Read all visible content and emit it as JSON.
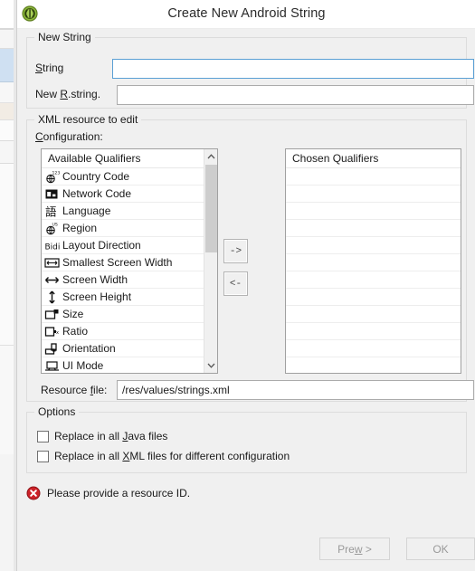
{
  "window": {
    "title": "Create New Android String",
    "icon": "android-green-circle-icon"
  },
  "new_string_group": {
    "title": "New String",
    "fields": [
      {
        "label_pre": "",
        "label_mn": "S",
        "label_post": "tring",
        "value": "",
        "placeholder": "",
        "focused": true
      },
      {
        "label_pre": "New ",
        "label_mn": "R",
        "label_post": ".string.",
        "value": "",
        "placeholder": "",
        "focused": false
      }
    ]
  },
  "xml_group": {
    "title": "XML resource to edit",
    "config_label_mn": "C",
    "config_label_rest": "onfiguration:",
    "available": {
      "header": "Available Qualifiers",
      "items": [
        {
          "icon": "country-code-globe-123-icon",
          "label": "Country Code"
        },
        {
          "icon": "network-code-sim-icon",
          "label": "Network Code"
        },
        {
          "icon": "language-cjk-icon",
          "label": "Language"
        },
        {
          "icon": "region-globe-us-icon",
          "label": "Region"
        },
        {
          "icon": "layout-direction-bidi-icon",
          "label": "Layout Direction"
        },
        {
          "icon": "smallest-screen-width-icon",
          "label": "Smallest Screen Width"
        },
        {
          "icon": "screen-width-arrows-icon",
          "label": "Screen Width"
        },
        {
          "icon": "screen-height-arrows-icon",
          "label": "Screen Height"
        },
        {
          "icon": "size-icon",
          "label": "Size"
        },
        {
          "icon": "ratio-icon",
          "label": "Ratio"
        },
        {
          "icon": "orientation-icon",
          "label": "Orientation"
        },
        {
          "icon": "ui-mode-icon",
          "label": "UI Mode"
        }
      ],
      "scroll_thumb_pct": 45
    },
    "chosen": {
      "header": "Chosen Qualifiers",
      "items": []
    },
    "move_right_label": "->",
    "move_left_label": "<-",
    "resource_file": {
      "label_pre": "Resource ",
      "label_mn": "f",
      "label_post": "ile:",
      "value": "/res/values/strings.xml"
    }
  },
  "options_group": {
    "title": "Options",
    "checkboxes": [
      {
        "pre": "Replace in all ",
        "mn": "J",
        "post": "ava files",
        "checked": false
      },
      {
        "pre": "Replace in all ",
        "mn": "X",
        "post": "ML files for different configuration",
        "checked": false
      }
    ]
  },
  "status": {
    "icon": "error-circle-icon",
    "message": "Please provide a resource ID.",
    "color": "#cc2128"
  },
  "buttons": {
    "preview_pre": "Pre",
    "preview_mn": "w",
    "preview_post": " >",
    "preview_label": "Preview >",
    "ok_label": "OK",
    "preview_enabled": false,
    "ok_enabled": false
  },
  "colors": {
    "dialog_bg": "#f0f0f0",
    "field_bg": "#ffffff",
    "focus_border": "#5a9fd4",
    "error_red": "#cc2128",
    "icon_green": "#7aa832"
  }
}
